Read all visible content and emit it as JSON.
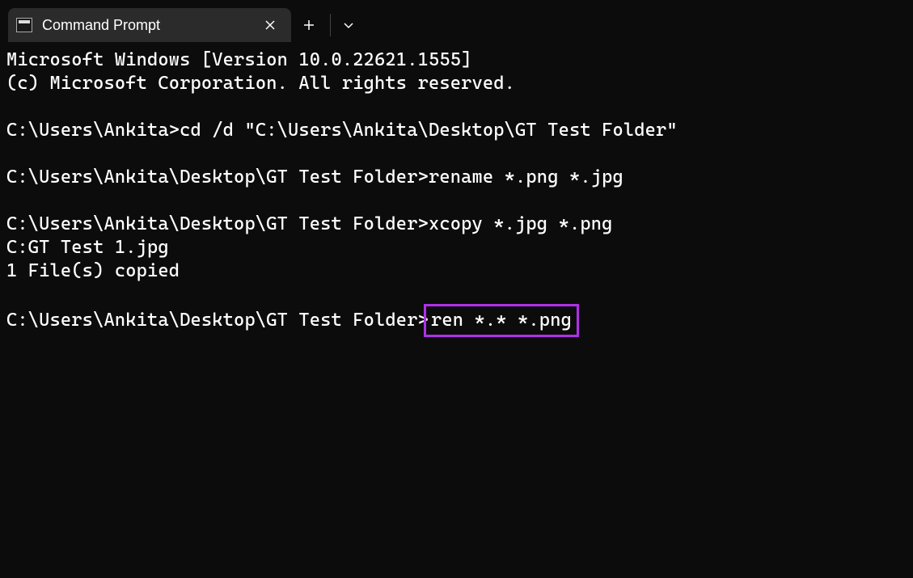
{
  "tab": {
    "title": "Command Prompt"
  },
  "terminal": {
    "line1": "Microsoft Windows [Version 10.0.22621.1555]",
    "line2": "(c) Microsoft Corporation. All rights reserved.",
    "blank1": "",
    "line3_prompt": "C:\\Users\\Ankita>",
    "line3_cmd": "cd /d \"C:\\Users\\Ankita\\Desktop\\GT Test Folder\"",
    "blank2": "",
    "line4_prompt": "C:\\Users\\Ankita\\Desktop\\GT Test Folder>",
    "line4_cmd": "rename *.png *.jpg",
    "blank3": "",
    "line5_prompt": "C:\\Users\\Ankita\\Desktop\\GT Test Folder>",
    "line5_cmd": "xcopy *.jpg *.png",
    "line6": "C:GT Test 1.jpg",
    "line7": "1 File(s) copied",
    "blank4": "",
    "line8_prompt": "C:\\Users\\Ankita\\Desktop\\GT Test Folder>",
    "line8_cmd": "ren *.* *.png"
  }
}
